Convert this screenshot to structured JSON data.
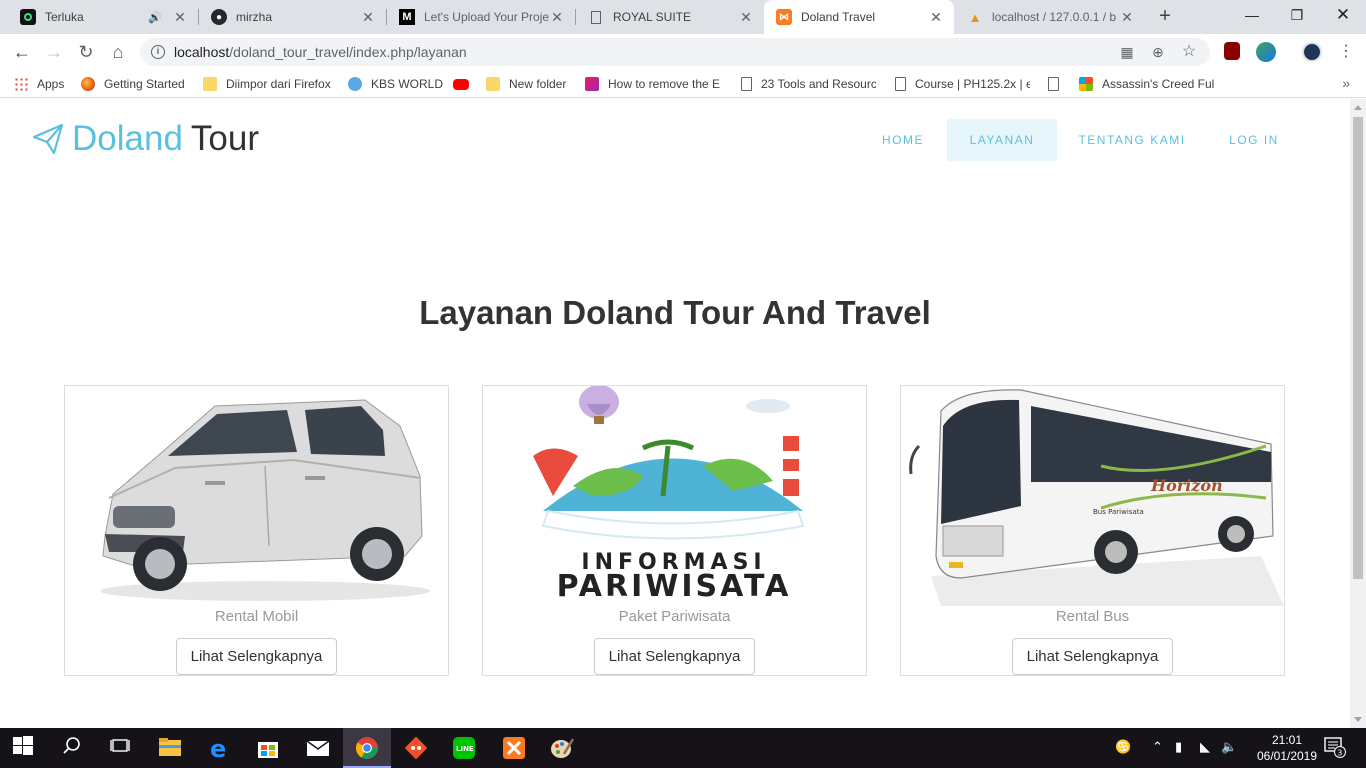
{
  "browser": {
    "tabs": [
      {
        "title": "Terluka",
        "icon": "music-app-icon",
        "audio": true
      },
      {
        "title": "mirzha",
        "icon": "github-icon"
      },
      {
        "title": "Let's Upload Your Proje",
        "icon": "medium-icon"
      },
      {
        "title": "ROYAL SUITE",
        "icon": "page-icon"
      },
      {
        "title": "Doland Travel",
        "icon": "xampp-icon",
        "active": true
      },
      {
        "title": "localhost / 127.0.0.1 / b",
        "icon": "phpmyadmin-icon"
      }
    ],
    "url_host": "localhost",
    "url_path": "/doland_tour_travel/index.php/layanan",
    "bookmarks": [
      {
        "label": "Apps",
        "icon": "apps-grid-icon"
      },
      {
        "label": "Getting Started",
        "icon": "firefox-icon"
      },
      {
        "label": "Diimpor dari Firefox",
        "icon": "folder-icon"
      },
      {
        "label": "KBS WORLD",
        "icon": "kbs-icon"
      },
      {
        "label": "",
        "icon": "youtube-icon"
      },
      {
        "label": "New folder",
        "icon": "folder-icon"
      },
      {
        "label": "How to remove the E",
        "icon": "bookmark-image-icon"
      },
      {
        "label": "23 Tools and Resourc",
        "icon": "page-icon"
      },
      {
        "label": "Course | PH125.2x | e",
        "icon": "page-icon"
      },
      {
        "label": "",
        "icon": "page-icon"
      },
      {
        "label": "Assassin's Creed Full",
        "icon": "windows-icon"
      }
    ]
  },
  "site": {
    "brand_part1": "Doland",
    "brand_part2": "Tour",
    "nav": [
      {
        "label": "HOME"
      },
      {
        "label": "LAYANAN",
        "active": true
      },
      {
        "label": "TENTANG KAMI"
      },
      {
        "label": "LOG IN"
      }
    ],
    "heading": "Layanan Doland Tour And Travel",
    "cards": [
      {
        "caption": "Rental Mobil",
        "button": "Lihat Selengkapnya",
        "image": "silver-mpv-car"
      },
      {
        "caption": "Paket Pariwisata",
        "button": "Lihat Selengkapnya",
        "image": "informasi-pariwisata-illustration",
        "image_text_1": "INFORMASI",
        "image_text_2": "PARIWISATA"
      },
      {
        "caption": "Rental Bus",
        "button": "Lihat Selengkapnya",
        "image": "horizon-tour-bus",
        "image_text_1": "Horizon",
        "image_text_2": "Bus Pariwisata"
      }
    ]
  },
  "taskbar": {
    "time": "21:01",
    "date": "06/01/2019",
    "notifications": "3"
  },
  "colors": {
    "accent": "#5bc0de",
    "nav_active_bg": "#e6f6fb",
    "tab_strip": "#dee1e6",
    "taskbar": "#161318"
  }
}
